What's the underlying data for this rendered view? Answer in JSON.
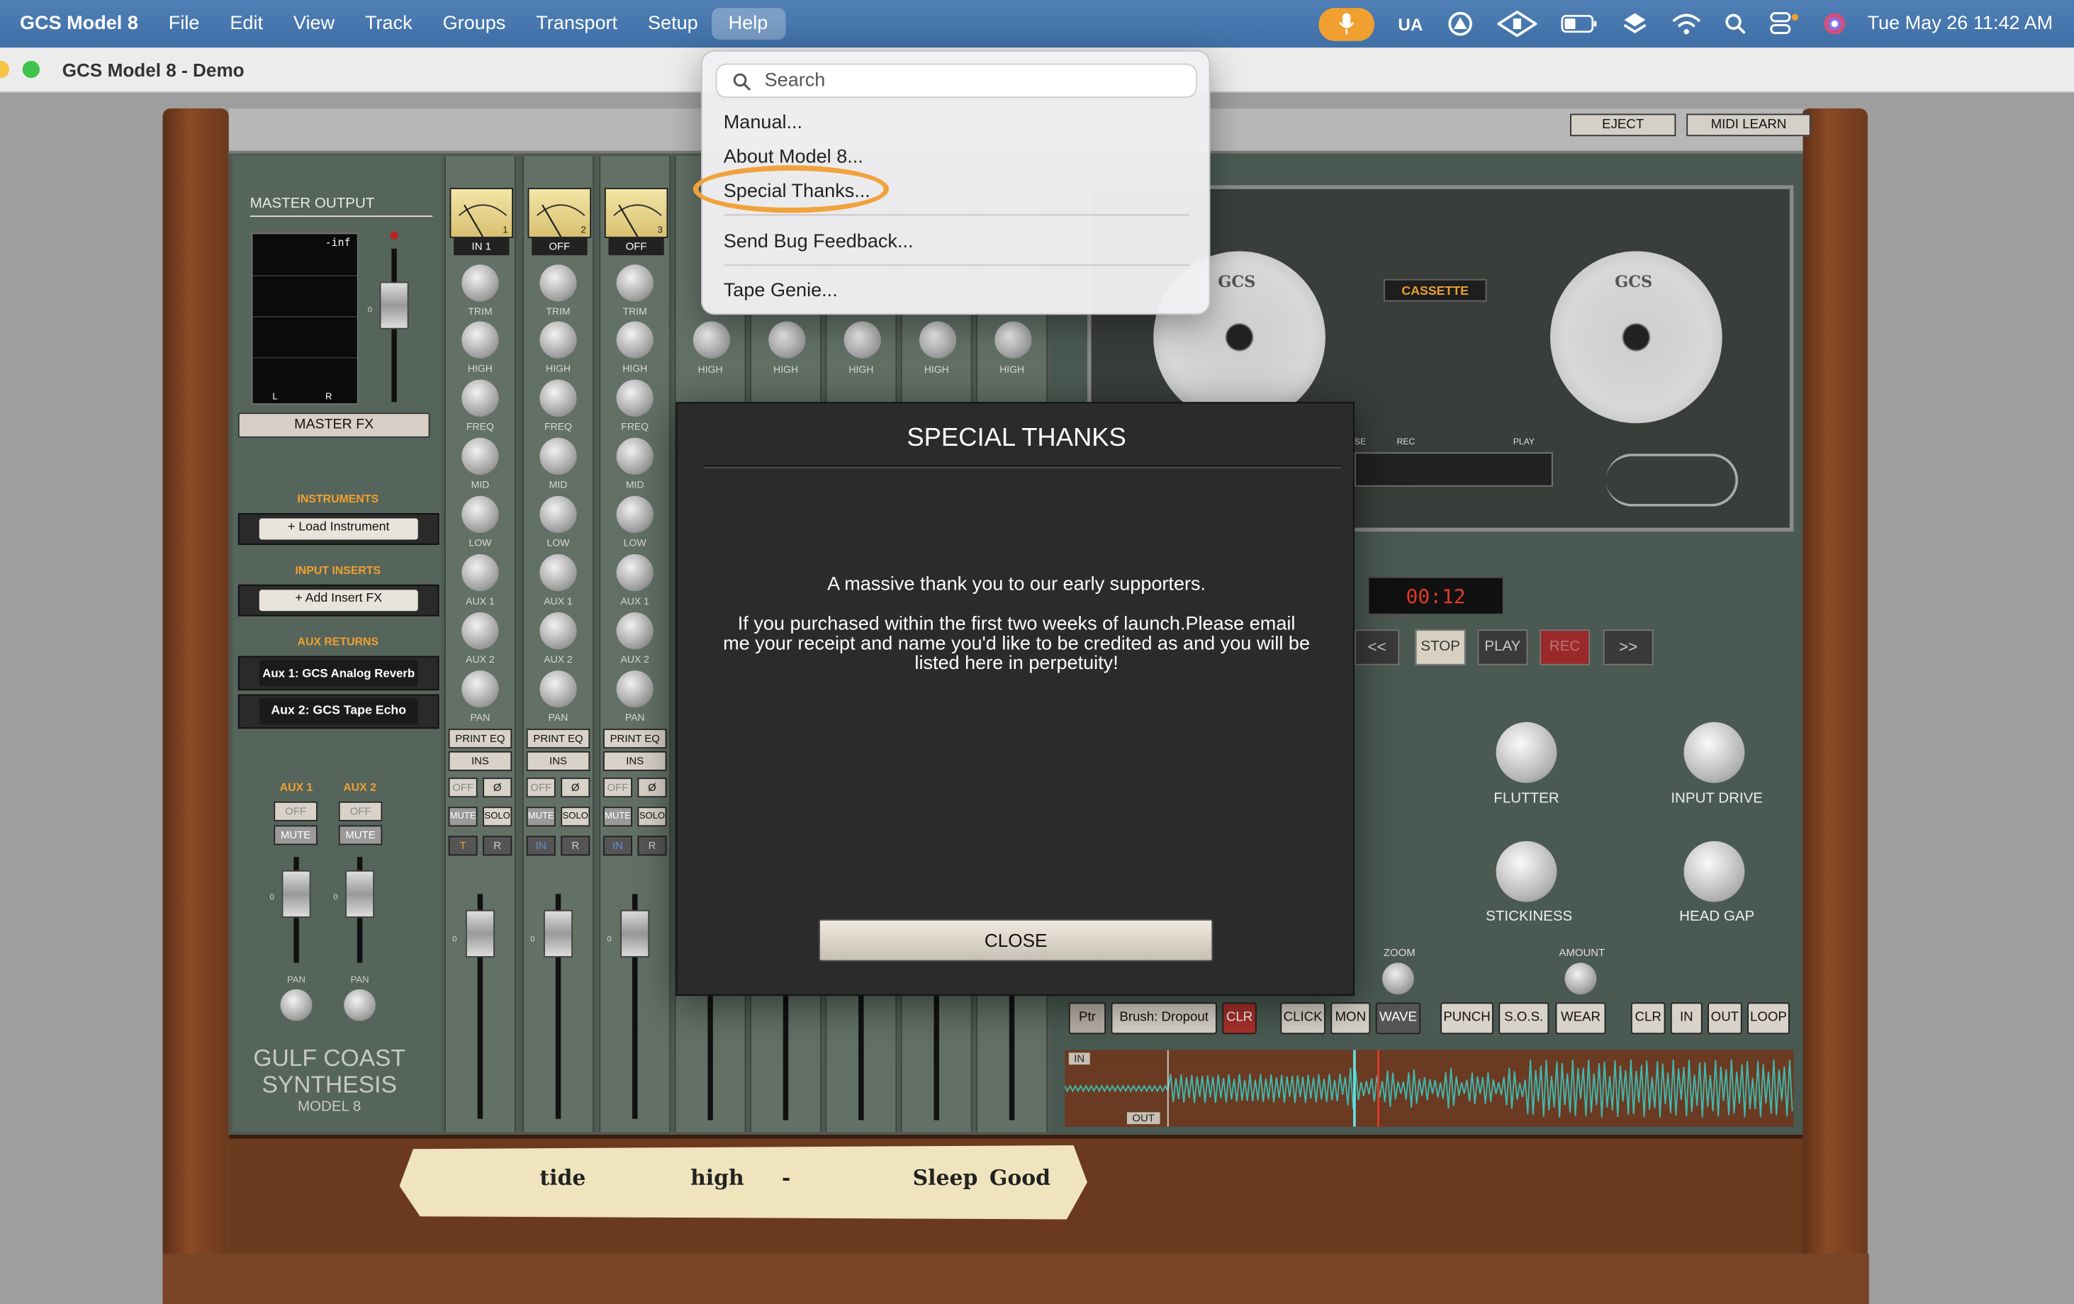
{
  "menubar": {
    "app_name": "GCS Model 8",
    "items": [
      "File",
      "Edit",
      "View",
      "Track",
      "Groups",
      "Transport",
      "Setup",
      "Help"
    ],
    "status_ua": "UA",
    "clock": "Tue May 26  11:42 AM"
  },
  "window": {
    "title": "GCS Model 8 - Demo"
  },
  "help_menu": {
    "search_placeholder": "Search",
    "items": [
      "Manual...",
      "About Model 8...",
      "Special Thanks...",
      "Send Bug Feedback...",
      "Tape Genie..."
    ],
    "highlighted_item": "Special Thanks...",
    "highlight_color": "#f2a23c"
  },
  "top_buttons": {
    "eject": "EJECT",
    "midi_learn": "MIDI LEARN"
  },
  "master": {
    "output_label": "MASTER OUTPUT",
    "meter_value": "-inf",
    "meter_l": "L",
    "meter_r": "R",
    "fader_zero": "0",
    "fx_button": "MASTER FX",
    "instruments_label": "INSTRUMENTS",
    "load_instrument": "+ Load Instrument",
    "input_inserts_label": "INPUT INSERTS",
    "add_insert": "+ Add Insert FX",
    "aux_returns_label": "AUX RETURNS",
    "aux1_return": "Aux 1: GCS Analog Reverb",
    "aux2_return": "Aux 2: GCS Tape Echo",
    "aux1_label": "AUX 1",
    "aux2_label": "AUX 2",
    "off": "OFF",
    "mute": "MUTE",
    "pan": "PAN"
  },
  "channels": [
    {
      "number": "1",
      "input": "IN 1",
      "rec": "T"
    },
    {
      "number": "2",
      "input": "OFF",
      "rec": "IN"
    },
    {
      "number": "3",
      "input": "OFF",
      "rec": "IN"
    }
  ],
  "channel_labels": {
    "trim": "TRIM",
    "high": "HIGH",
    "freq": "FREQ",
    "mid": "MID",
    "low": "LOW",
    "aux1": "AUX 1",
    "aux2": "AUX 2",
    "pan": "PAN",
    "print_eq": "PRINT EQ",
    "ins": "INS",
    "off": "OFF",
    "phase": "Ø",
    "mute": "MUTE",
    "solo": "SOLO",
    "r": "R",
    "zero": "0"
  },
  "brand": {
    "line1": "GULF COAST",
    "line2": "SYNTHESIS",
    "line3": "MODEL 8",
    "reel_logo": "GCS"
  },
  "tape": {
    "format": "CASSETTE",
    "rec_label": "REC",
    "play_label": "PLAY",
    "se_label": "SE",
    "counter": "00:12",
    "transport": [
      "<<",
      "STOP",
      "PLAY",
      "REC",
      ">>"
    ],
    "knobs": [
      "FLUTTER",
      "INPUT DRIVE",
      "STICKINESS",
      "HEAD GAP"
    ],
    "zoom": "ZOOM",
    "amount": "AMOUNT",
    "left_buttons": [
      "Ptr",
      "Brush: Dropout",
      "CLR"
    ],
    "mid_buttons": [
      "CLICK",
      "MON",
      "WAVE"
    ],
    "punch_buttons": [
      "PUNCH",
      "S.O.S.",
      "WEAR"
    ],
    "loop_buttons": [
      "CLR",
      "IN",
      "OUT",
      "LOOP"
    ],
    "wave_in": "IN",
    "wave_out": "OUT",
    "wave_color": "#3fb9b0"
  },
  "masking_tape": {
    "words": [
      "tide",
      "high",
      "-",
      "Sleep",
      "Good"
    ]
  },
  "modal": {
    "title": "SPECIAL THANKS",
    "line1": "A massive thank you to our early supporters.",
    "line2": "If you purchased within the first two weeks of launch.Please email me your receipt and name you'd like to be credited as and you will be listed here in perpetuity!",
    "close": "CLOSE"
  }
}
